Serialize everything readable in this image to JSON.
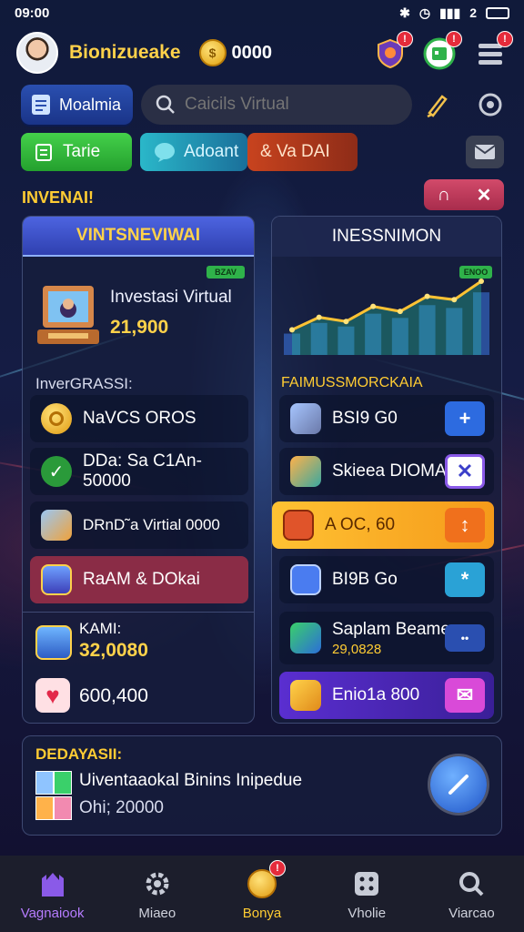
{
  "status": {
    "time": "09:00",
    "battery": "2"
  },
  "header": {
    "username": "Bionizueake",
    "coin_symbol": "$",
    "coins": "0000"
  },
  "toolbar": {
    "module_label": "Moalmia",
    "search_placeholder": "Caicils Virtual"
  },
  "tabs": {
    "tab1": "Tarie",
    "tab2": "Adoant",
    "tab3": "& Va DAI"
  },
  "section": {
    "title": "INVENAI!"
  },
  "left_panel": {
    "title": "VINTSNEVIWAI",
    "tag": "BZAV",
    "hero_title": "Investasi Virtual",
    "hero_value": "21,900",
    "sub_label": "InverGRASSI:",
    "rows": [
      {
        "label": "NaVCS OROS"
      },
      {
        "label": "DDa: Sa C1An-50000"
      },
      {
        "label": "DRnD˜a Virtial  0000"
      },
      {
        "label": "RaAM & DOkai"
      }
    ],
    "stat_label": "KAMI:",
    "stat_value": "32,0080",
    "heart_value": "600,400"
  },
  "right_panel": {
    "title": "INESSNIMON",
    "tag": "ENOO",
    "sub_label": "FAIMUSSMORCKAIA",
    "rows": [
      {
        "label": "BSI9 G0",
        "action": "+"
      },
      {
        "label": "Skieea DIOMAS",
        "action": "✕"
      },
      {
        "label": "A OC, 60",
        "action": "↕"
      },
      {
        "label": "BI9B Go",
        "action": "*"
      },
      {
        "label": "Saplam Beamee",
        "sub": "29,0828",
        "action": "••"
      },
      {
        "label": "Enio1a 800",
        "action": "✉"
      }
    ]
  },
  "bottom_card": {
    "title": "DEDAYASII:",
    "text": "Uiventaaokal Binins Inipedue",
    "value": "Ohi; 20000"
  },
  "nav": [
    {
      "label": "Vagnaiook"
    },
    {
      "label": "Miaeo"
    },
    {
      "label": "Bonya"
    },
    {
      "label": "Vholie"
    },
    {
      "label": "Viarcao"
    }
  ],
  "colors": {
    "accent": "#ffcc33",
    "panel_head_left": "#3b52c8",
    "nav_active": "#b67cff"
  },
  "chart_data": {
    "type": "area",
    "x": [
      1,
      2,
      3,
      4,
      5,
      6,
      7,
      8
    ],
    "values": [
      30,
      45,
      40,
      58,
      52,
      70,
      66,
      88
    ],
    "title": "",
    "xlabel": "",
    "ylabel": ""
  }
}
